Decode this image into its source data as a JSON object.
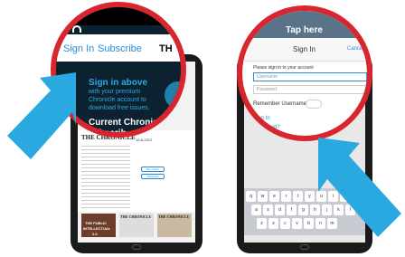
{
  "left": {
    "nav": {
      "sign_in": "Sign In",
      "subscribe": "Subscribe",
      "title_fragment": "TH"
    },
    "promo": {
      "line1": "Sign in above",
      "line2": "with your premium",
      "line3": "Chronicle account to",
      "line4": "download free issues.",
      "line5": "Current Chronic",
      "line6": "subscrib"
    },
    "issue": {
      "masthead": "THE CHRONICLE",
      "date": "10-8-2012",
      "buy_label": "Buy Issue",
      "subscribe_label": "Subscribe"
    },
    "thumbs": [
      {
        "masthead": "THE CHRONICLE"
      },
      {
        "masthead": "THE CHRONICLE"
      }
    ],
    "cover_text": {
      "line1": "THE PUBLIC",
      "line2": "INTELLECTUAL",
      "line3": "2.0"
    }
  },
  "right": {
    "banner": "Tap here",
    "modal": {
      "title": "Sign In",
      "cancel": "Cancel",
      "prompt": "Please sign in to your account",
      "username_ph": "Username",
      "password_ph": "Password",
      "remember": "Remember Username",
      "sign_in_link": "Sign In",
      "forgot": "Password?"
    },
    "keyboard": {
      "rows": [
        [
          "q",
          "w",
          "e",
          "r",
          "t",
          "y",
          "u",
          "i",
          "o",
          "p"
        ],
        [
          "a",
          "s",
          "d",
          "f",
          "g",
          "h",
          "j",
          "k",
          "l"
        ],
        [
          "z",
          "x",
          "c",
          "v",
          "b",
          "n",
          "m"
        ]
      ]
    }
  },
  "colors": {
    "accent": "#2aa8e0",
    "ring": "#d7262d",
    "link": "#2a8bd8"
  }
}
